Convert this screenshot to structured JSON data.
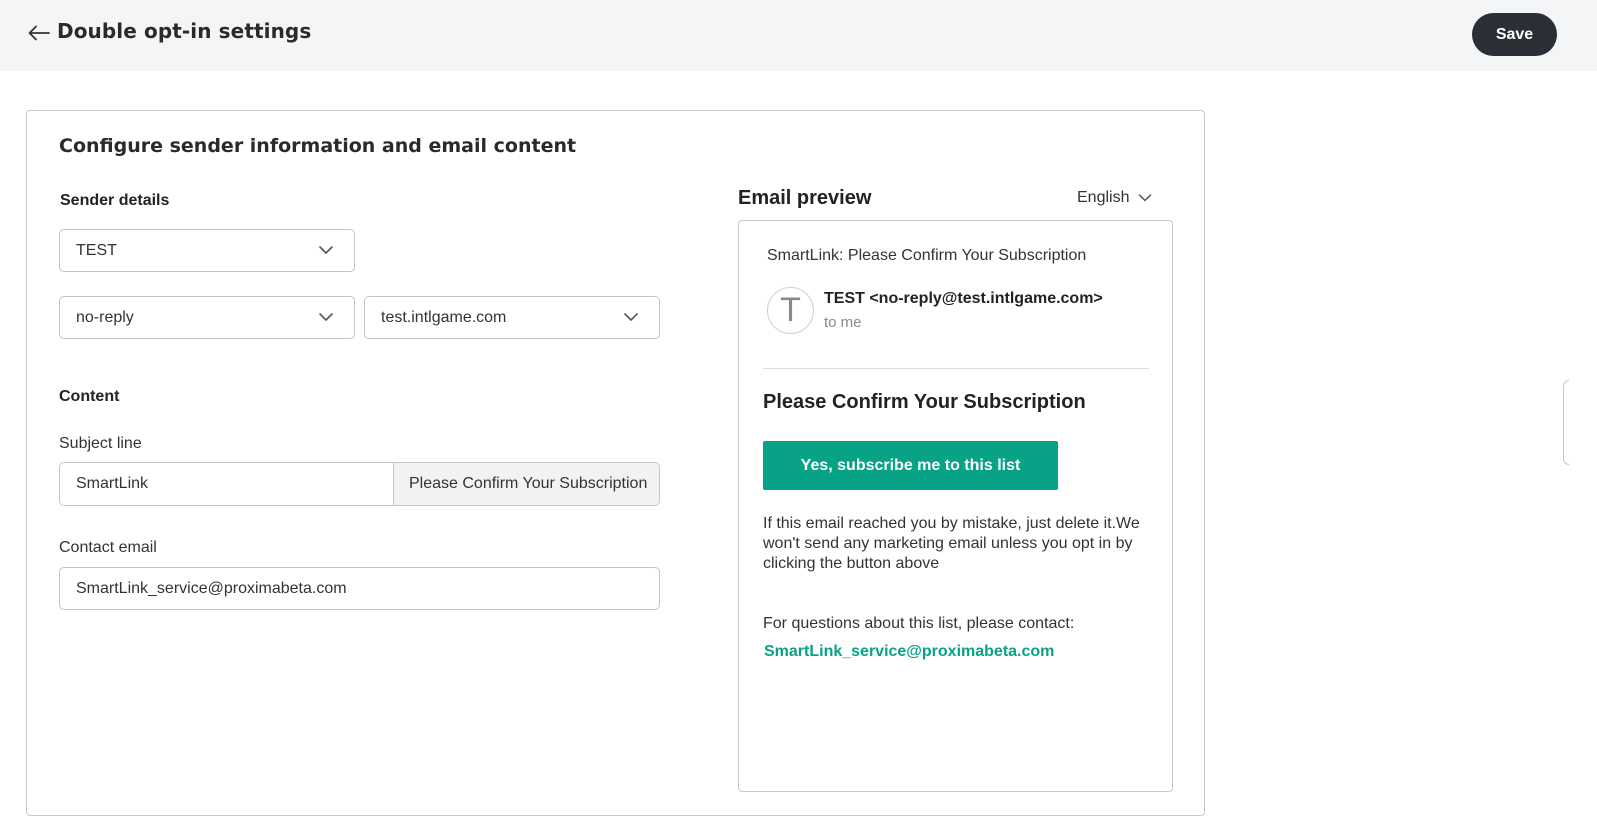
{
  "header": {
    "title": "Double opt-in settings",
    "save_label": "Save"
  },
  "card": {
    "title": "Configure sender information and email content",
    "sender": {
      "label": "Sender details",
      "name_value": "TEST",
      "local_part_value": "no-reply",
      "domain_value": "test.intlgame.com"
    },
    "content": {
      "label": "Content",
      "subject_label": "Subject line",
      "subject_prefix": "SmartLink",
      "subject_text": "Please Confirm Your Subscription",
      "contact_label": "Contact email",
      "contact_value": "SmartLink_service@proximabeta.com"
    }
  },
  "preview": {
    "title": "Email preview",
    "language": "English",
    "subject": "SmartLink: Please Confirm Your Subscription",
    "avatar_letter": "T",
    "from": "TEST <no-reply@test.intlgame.com>",
    "to": "to me",
    "heading": "Please Confirm Your Subscription",
    "cta_label": "Yes, subscribe me to this list",
    "note": "If this email reached you by mistake, just delete it.We won't send any marketing email unless you opt in by clicking the button above",
    "questions": "For questions about this list, please contact:",
    "contact_email": "SmartLink_service@proximabeta.com"
  },
  "icons": {
    "back": "arrow-left-icon",
    "dropdown": "chevron-down-icon"
  },
  "colors": {
    "accent": "#08a287",
    "save_button": "#2b2e35",
    "header_bg": "#f4f5f7"
  }
}
